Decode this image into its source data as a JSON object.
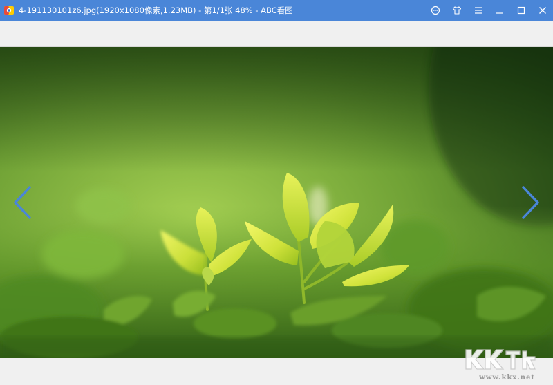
{
  "window": {
    "title": "4-191130101z6.jpg(1920x1080像素,1.23MB) - 第1/1张 48% - ABC看图",
    "icons": [
      "feedback-icon",
      "skin-icon",
      "menu-icon",
      "minimize-icon",
      "maximize-icon",
      "close-icon"
    ]
  },
  "viewer": {
    "prev_icon": "chevron-left-icon",
    "next_icon": "chevron-right-icon",
    "accent_color": "#4a86d8"
  },
  "watermark": {
    "brand": "KK下载",
    "site": "www.kkx.net"
  }
}
